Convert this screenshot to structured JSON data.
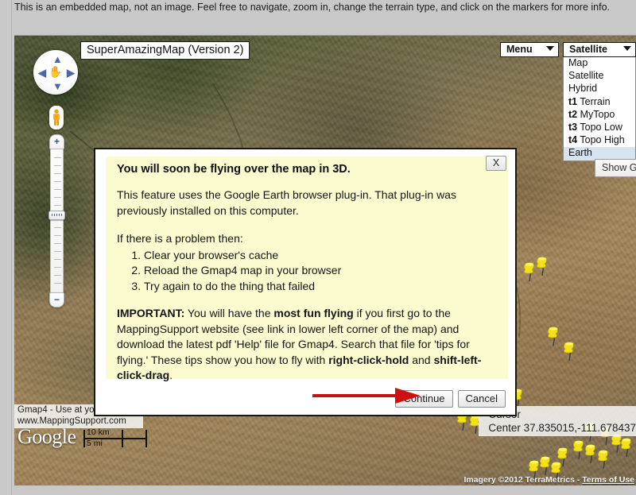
{
  "page": {
    "intro_text": "This is an embedded map, not an image. Feel free to navigate, zoom in, change the terrain type, and click on the markers for more info."
  },
  "map": {
    "title": "SuperAmazingMap (Version 2)",
    "pan_control": {
      "up_icon": "chevron-up-icon",
      "down_icon": "chevron-down-icon",
      "left_icon": "chevron-left-icon",
      "right_icon": "chevron-right-icon",
      "hand_icon": "pan-hand-icon"
    },
    "zoom": {
      "zoom_in_label": "+",
      "zoom_out_label": "−"
    },
    "menu_button": {
      "label": "Menu",
      "caret_icon": "chevron-down-icon"
    },
    "layer_button": {
      "label": "Satellite",
      "caret_icon": "chevron-down-icon"
    },
    "layer_options": [
      {
        "label": "Map",
        "prefix": "",
        "selected": false
      },
      {
        "label": "Satellite",
        "prefix": "",
        "selected": false
      },
      {
        "label": "Hybrid",
        "prefix": "",
        "selected": false
      },
      {
        "label": "Terrain",
        "prefix": "t1",
        "selected": false
      },
      {
        "label": "MyTopo",
        "prefix": "t2",
        "selected": false
      },
      {
        "label": "Topo Low",
        "prefix": "t3",
        "selected": false
      },
      {
        "label": "Topo High",
        "prefix": "t4",
        "selected": false
      },
      {
        "label": "Earth",
        "prefix": "",
        "selected": true
      }
    ],
    "show_g_button": "Show G",
    "credit_line1": "Gmap4 - Use at your own risk",
    "credit_line2": "www.MappingSupport.com",
    "google_logo": "Google",
    "scale_km": "10 km",
    "scale_mi": "5 mi",
    "cursor_label": "Cursor",
    "center_label": "Center 37.835015,-111.678437",
    "imagery_credit": "Imagery ©2012 TerraMetrics",
    "terms_link": "Terms of Use"
  },
  "dialog": {
    "heading": "You will soon be flying over the map in 3D.",
    "close_label": "X",
    "paragraph1": "This feature uses the Google Earth browser plug-in. That plug-in was previously installed on this computer.",
    "paragraph2": "If there is a problem then:",
    "steps": [
      "Clear your browser's cache",
      "Reload the Gmap4 map in your browser",
      "Try again to do the thing that failed"
    ],
    "important_label": "IMPORTANT:",
    "important_a": " You will have the ",
    "important_b": "most fun flying",
    "important_c": " if you first go to the MappingSupport website (see link in lower left corner of the map) and download the latest pdf 'Help' file for Gmap4. Search that file for 'tips for flying.' These tips show you how to fly with ",
    "important_d": "right-click-hold",
    "important_e": " and ",
    "important_f": "shift-left-click-drag",
    "important_g": ".",
    "continue_label": "Continue",
    "cancel_label": "Cancel"
  },
  "colors": {
    "dialog_bg": "#fbfbcf",
    "highlight": "#d8e3f0",
    "arrow": "#cc1111",
    "pin": "#f2e119"
  }
}
